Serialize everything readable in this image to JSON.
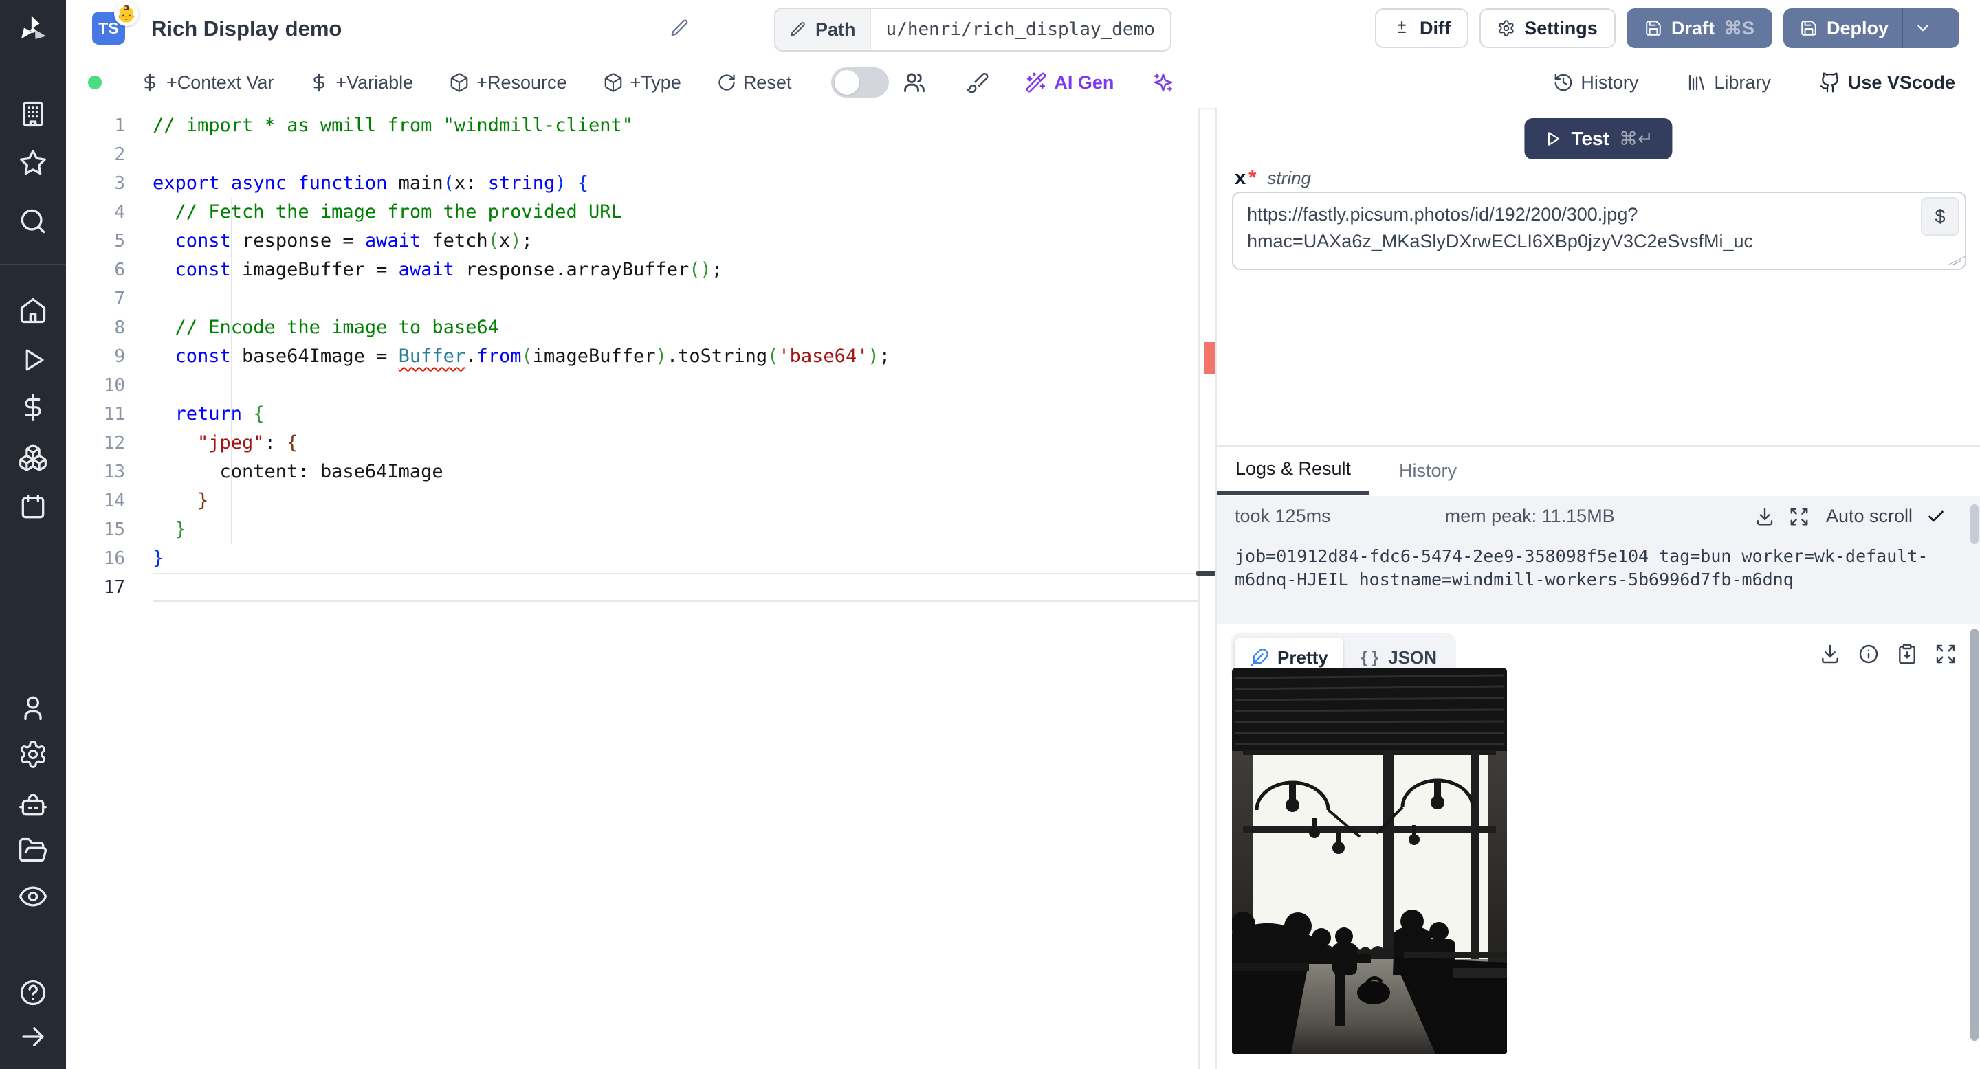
{
  "topbar": {
    "lang_badge": "TS",
    "badge_emoji": "👶",
    "title": "Rich Display demo",
    "path_label": "Path",
    "path_value": "u/henri/rich_display_demo",
    "diff_label": "Diff",
    "settings_label": "Settings",
    "draft_label": "Draft",
    "draft_shortcut": "⌘S",
    "deploy_label": "Deploy"
  },
  "toolbar": {
    "items": [
      "+Context Var",
      "+Variable",
      "+Resource",
      "+Type",
      "Reset"
    ],
    "ai_gen_label": "AI Gen",
    "history_label": "History",
    "library_label": "Library",
    "vscode_label": "Use VScode"
  },
  "sidebar": {
    "icons": [
      "windmill-logo",
      "building",
      "star",
      "search",
      "home",
      "play",
      "dollar",
      "boxes",
      "calendar",
      "user",
      "settings",
      "bot",
      "folder-open",
      "eye",
      "help",
      "arrow-right"
    ]
  },
  "editor": {
    "active_line": 17,
    "lines": [
      {
        "n": 1,
        "segs": [
          {
            "c": "com",
            "t": "// import * as wmill from \"windmill-client\""
          }
        ]
      },
      {
        "n": 2,
        "segs": []
      },
      {
        "n": 3,
        "segs": [
          {
            "c": "kw",
            "t": "export"
          },
          {
            "c": "def",
            "t": " "
          },
          {
            "c": "kw",
            "t": "async"
          },
          {
            "c": "def",
            "t": " "
          },
          {
            "c": "kw",
            "t": "function"
          },
          {
            "c": "def",
            "t": " main"
          },
          {
            "c": "b1",
            "t": "("
          },
          {
            "c": "def",
            "t": "x: "
          },
          {
            "c": "kw",
            "t": "string"
          },
          {
            "c": "b1",
            "t": ")"
          },
          {
            "c": "def",
            "t": " "
          },
          {
            "c": "b1",
            "t": "{"
          }
        ]
      },
      {
        "n": 4,
        "segs": [
          {
            "c": "def",
            "t": "  "
          },
          {
            "c": "com",
            "t": "// Fetch the image from the provided URL"
          }
        ]
      },
      {
        "n": 5,
        "segs": [
          {
            "c": "def",
            "t": "  "
          },
          {
            "c": "kw",
            "t": "const"
          },
          {
            "c": "def",
            "t": " response = "
          },
          {
            "c": "kw",
            "t": "await"
          },
          {
            "c": "def",
            "t": " fetch"
          },
          {
            "c": "b2",
            "t": "("
          },
          {
            "c": "def",
            "t": "x"
          },
          {
            "c": "b2",
            "t": ")"
          },
          {
            "c": "def",
            "t": ";"
          }
        ]
      },
      {
        "n": 6,
        "segs": [
          {
            "c": "def",
            "t": "  "
          },
          {
            "c": "kw",
            "t": "const"
          },
          {
            "c": "def",
            "t": " imageBuffer = "
          },
          {
            "c": "kw",
            "t": "await"
          },
          {
            "c": "def",
            "t": " response.arrayBuffer"
          },
          {
            "c": "b2",
            "t": "()"
          },
          {
            "c": "def",
            "t": ";"
          }
        ]
      },
      {
        "n": 7,
        "segs": []
      },
      {
        "n": 8,
        "segs": [
          {
            "c": "def",
            "t": "  "
          },
          {
            "c": "com",
            "t": "// Encode the image to base64"
          }
        ]
      },
      {
        "n": 9,
        "segs": [
          {
            "c": "def",
            "t": "  "
          },
          {
            "c": "kw",
            "t": "const"
          },
          {
            "c": "def",
            "t": " base64Image = "
          },
          {
            "c": "buf",
            "t": "Buffer"
          },
          {
            "c": "def",
            "t": "."
          },
          {
            "c": "kw",
            "t": "from"
          },
          {
            "c": "b2",
            "t": "("
          },
          {
            "c": "def",
            "t": "imageBuffer"
          },
          {
            "c": "b2",
            "t": ")"
          },
          {
            "c": "def",
            "t": ".toString"
          },
          {
            "c": "b2",
            "t": "("
          },
          {
            "c": "str",
            "t": "'base64'"
          },
          {
            "c": "b2",
            "t": ")"
          },
          {
            "c": "def",
            "t": ";"
          }
        ]
      },
      {
        "n": 10,
        "segs": []
      },
      {
        "n": 11,
        "segs": [
          {
            "c": "def",
            "t": "  "
          },
          {
            "c": "kw",
            "t": "return"
          },
          {
            "c": "def",
            "t": " "
          },
          {
            "c": "b2",
            "t": "{"
          }
        ]
      },
      {
        "n": 12,
        "segs": [
          {
            "c": "def",
            "t": "    "
          },
          {
            "c": "str",
            "t": "\"jpeg\""
          },
          {
            "c": "def",
            "t": ": "
          },
          {
            "c": "b3",
            "t": "{"
          }
        ]
      },
      {
        "n": 13,
        "segs": [
          {
            "c": "def",
            "t": "      content: base64Image"
          }
        ]
      },
      {
        "n": 14,
        "segs": [
          {
            "c": "def",
            "t": "    "
          },
          {
            "c": "b3",
            "t": "}"
          }
        ]
      },
      {
        "n": 15,
        "segs": [
          {
            "c": "def",
            "t": "  "
          },
          {
            "c": "b2",
            "t": "}"
          }
        ]
      },
      {
        "n": 16,
        "segs": [
          {
            "c": "b1",
            "t": "}"
          }
        ]
      },
      {
        "n": 17,
        "segs": []
      }
    ]
  },
  "run_panel": {
    "test_label": "Test",
    "test_shortcut": "⌘↵",
    "arg_name": "x",
    "arg_required": "*",
    "arg_type": "string",
    "arg_value": "https://fastly.picsum.photos/id/192/200/300.jpg?hmac=UAXa6z_MKaSlyDXrwECLI6XBp0jzyV3C2eSvsfMi_uc",
    "dollar_button": "$"
  },
  "results": {
    "tab_logs": "Logs & Result",
    "tab_history": "History",
    "active_tab": "Logs & Result",
    "took": "took 125ms",
    "mem_peak": "mem peak: 11.15MB",
    "autoscroll_label": "Auto scroll",
    "log_text": "job=01912d84-fdc6-5474-2ee9-358098f5e104 tag=bun worker=wk-default-m6dnq-HJEIL hostname=windmill-workers-5b6996d7fb-m6dnq",
    "view_pretty": "Pretty",
    "view_json": "JSON",
    "active_view": "Pretty",
    "result_image_alt": "black and white cafe interior with window silhouettes"
  },
  "colors": {
    "sidebar_bg": "#252a33",
    "ts_badge": "#4678e6",
    "primary_button": "#64789f",
    "test_button": "#333e5e",
    "ai_accent": "#7c3aed",
    "run_dot": "#4ade80",
    "error_marker": "#f2756a",
    "active_tab_underline": "#3b4352"
  }
}
